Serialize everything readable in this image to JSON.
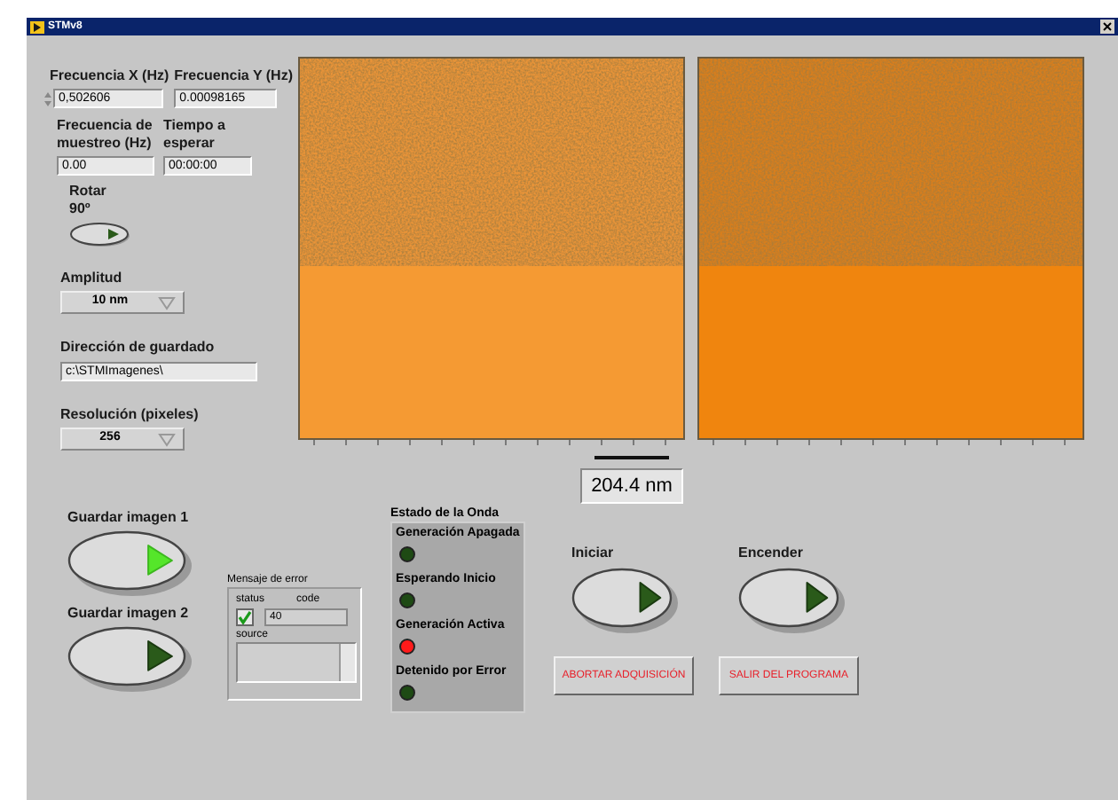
{
  "window": {
    "title": "STMv8"
  },
  "freq_x": {
    "label": "Frecuencia X (Hz)",
    "value": "0,502606"
  },
  "freq_y": {
    "label": "Frecuencia Y (Hz)",
    "value": "0.00098165"
  },
  "sample_rate": {
    "label": "Frecuencia de muestreo (Hz)",
    "value": "0.00"
  },
  "wait_time": {
    "label": "Tiempo a esperar",
    "value": "00:00:00"
  },
  "rotate": {
    "label": "Rotar 90º",
    "on": false
  },
  "amplitude": {
    "label": "Amplitud",
    "value": "10 nm"
  },
  "save_path": {
    "label": "Dirección de guardado",
    "value": "c:\\STMImagenes\\"
  },
  "resolution": {
    "label": "Resolución (pixeles)",
    "value": "256"
  },
  "scale_label": "204.4 nm",
  "save_buttons": [
    {
      "label": "Guardar imagen 1",
      "on": true
    },
    {
      "label": "Guardar imagen 2",
      "on": false
    }
  ],
  "error": {
    "title": "Mensaje de error",
    "status_label": "status",
    "code_label": "code",
    "status_checked": true,
    "code": "40",
    "source_label": "source"
  },
  "wave_state": {
    "title": "Estado de la Onda",
    "leds": [
      {
        "label": "Generación Apagada",
        "color": "#1e4a14"
      },
      {
        "label": "Esperando Inicio",
        "color": "#1e4a14"
      },
      {
        "label": "Generación Activa",
        "color": "#ff1a1a"
      },
      {
        "label": "Detenido por Error",
        "color": "#1e4a14"
      }
    ]
  },
  "action_buttons": [
    {
      "label": "Iniciar",
      "on": false
    },
    {
      "label": "Encender",
      "on": false
    }
  ],
  "text_buttons": [
    "ABORTAR ADQUISICIÓN",
    "SALIR DEL PROGRAMA"
  ]
}
